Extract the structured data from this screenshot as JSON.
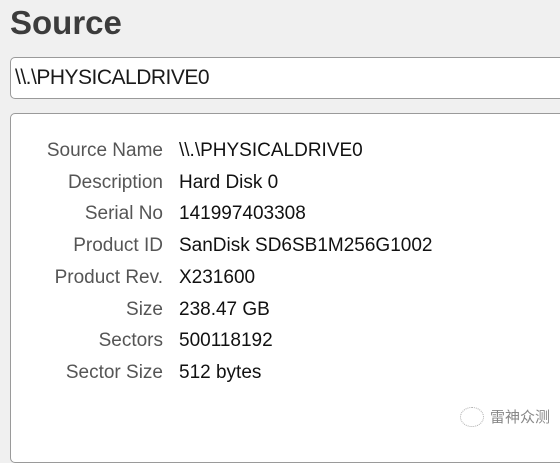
{
  "title": "Source",
  "source_input": {
    "value": "\\\\.\\PHYSICALDRIVE0"
  },
  "details": [
    {
      "label": "Source Name",
      "value": "\\\\.\\PHYSICALDRIVE0"
    },
    {
      "label": "Description",
      "value": "Hard Disk 0"
    },
    {
      "label": "Serial No",
      "value": "141997403308"
    },
    {
      "label": "Product ID",
      "value": "SanDisk SD6SB1M256G1002"
    },
    {
      "label": "Product Rev.",
      "value": "X231600"
    },
    {
      "label": "Size",
      "value": "238.47 GB"
    },
    {
      "label": "Sectors",
      "value": "500118192"
    },
    {
      "label": "Sector Size",
      "value": "512 bytes"
    }
  ],
  "watermark": "雷神众测"
}
